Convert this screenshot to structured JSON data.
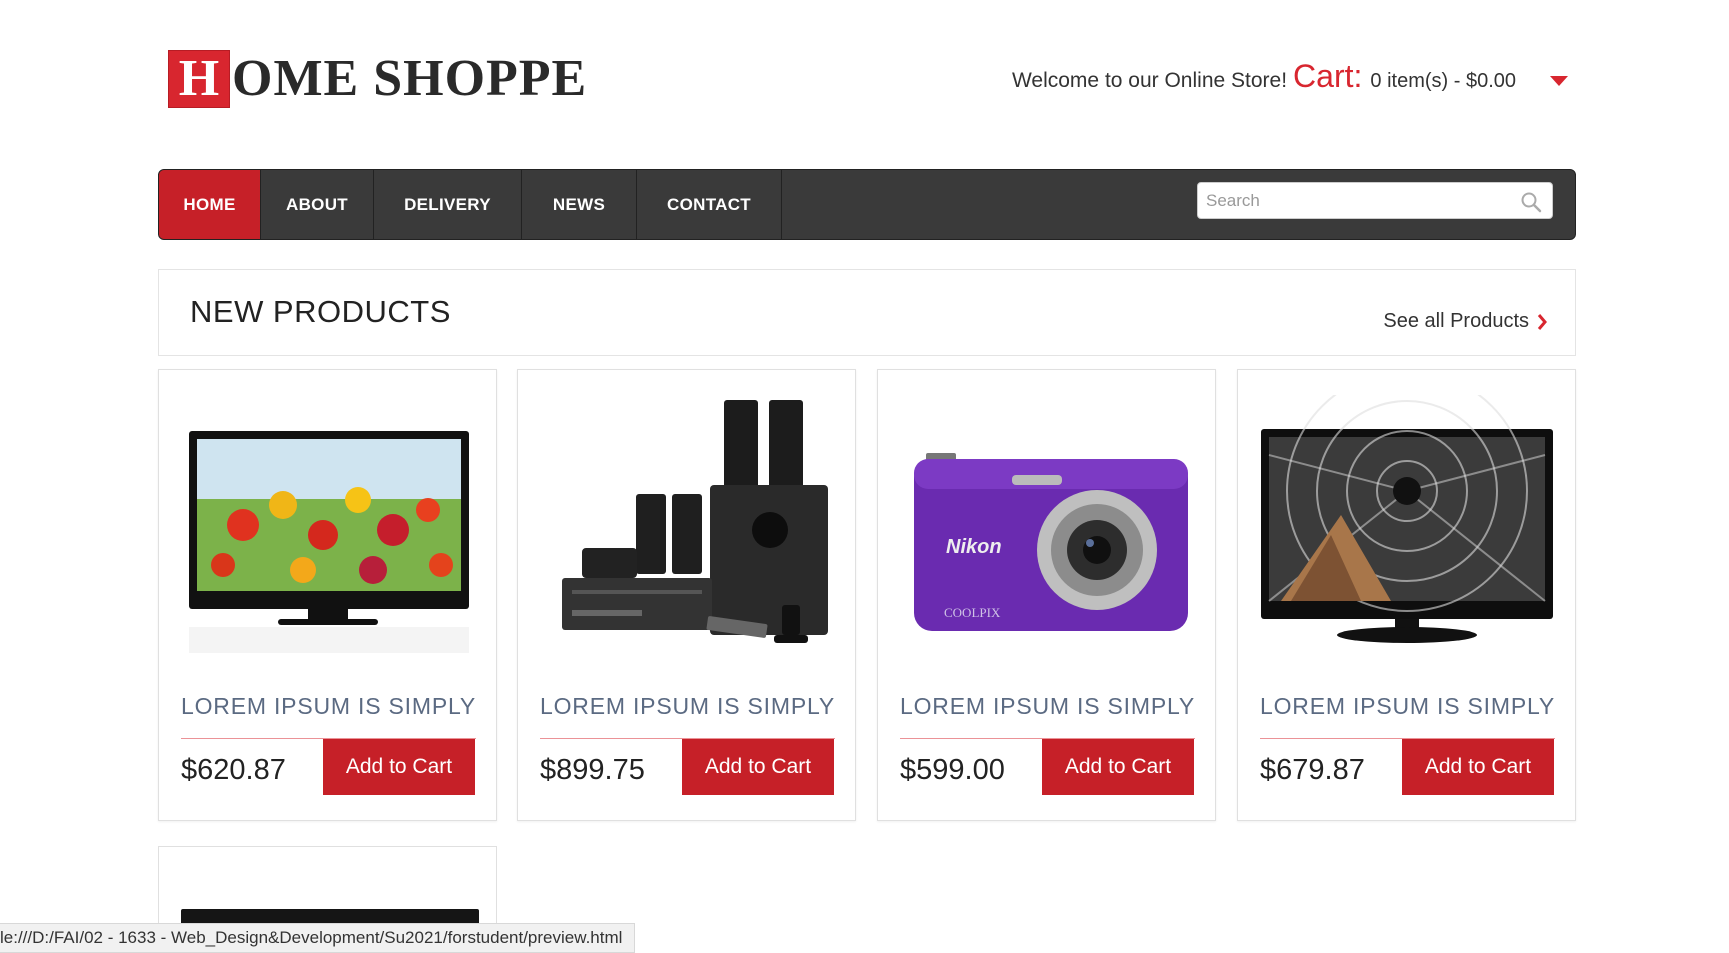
{
  "header": {
    "logo_letter": "H",
    "logo_text": "OME SHOPPE",
    "welcome": "Welcome to our Online Store!",
    "cart_label": "Cart:",
    "cart_info": "0 item(s) - $0.00"
  },
  "nav": {
    "items": [
      {
        "label": "HOME",
        "active": true
      },
      {
        "label": "ABOUT"
      },
      {
        "label": "DELIVERY"
      },
      {
        "label": "NEWS"
      },
      {
        "label": "CONTACT"
      }
    ],
    "search_placeholder": "Search"
  },
  "section": {
    "title": "NEW PRODUCTS",
    "see_all": "See all Products"
  },
  "products": [
    {
      "name": "LOREM IPSUM IS SIMPLY",
      "price": "$620.87",
      "button": "Add to Cart",
      "image": "tv-flowers"
    },
    {
      "name": "LOREM IPSUM IS SIMPLY",
      "price": "$899.75",
      "button": "Add to Cart",
      "image": "speaker-system"
    },
    {
      "name": "LOREM IPSUM IS SIMPLY",
      "price": "$599.00",
      "button": "Add to Cart",
      "image": "nikon-camera"
    },
    {
      "name": "LOREM IPSUM IS SIMPLY",
      "price": "$679.87",
      "button": "Add to Cart",
      "image": "tv-dome"
    }
  ],
  "statusbar": {
    "url": "le:///D:/FAI/02 - 1633 - Web_Design&Development/Su2021/forstudent/preview.html"
  },
  "colors": {
    "accent": "#c62028",
    "nav_bg": "#3a3a3a",
    "product_name": "#5b6a82"
  }
}
